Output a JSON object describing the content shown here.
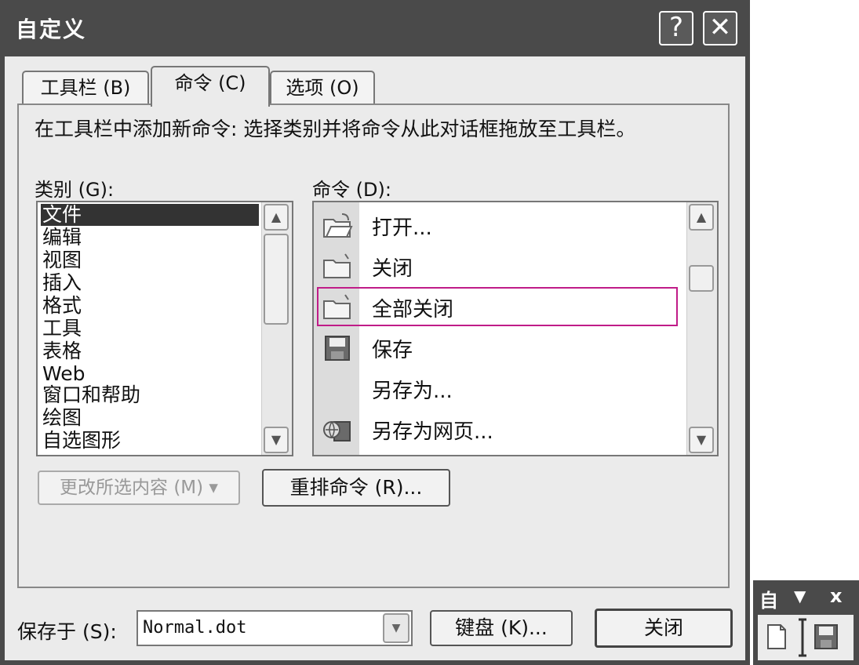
{
  "window": {
    "title": "自定义",
    "help_btn": "?",
    "close_btn": "✕"
  },
  "tabs": [
    {
      "label": "工具栏 (B)"
    },
    {
      "label": "命令 (C)"
    },
    {
      "label": "选项 (O)"
    }
  ],
  "panel": {
    "description": "在工具栏中添加新命令: 选择类别并将命令从此对话框拖放至工具栏。",
    "categories_label": "类别 (G):",
    "commands_label": "命令 (D):",
    "categories": [
      "文件",
      "编辑",
      "视图",
      "插入",
      "格式",
      "工具",
      "表格",
      "Web",
      "窗口和帮助",
      "绘图",
      "自选图形"
    ],
    "commands": [
      {
        "label": "打开...",
        "icon": "open-folder-icon"
      },
      {
        "label": "关闭",
        "icon": "close-folder-icon"
      },
      {
        "label": "全部关闭",
        "icon": "close-all-folder-icon"
      },
      {
        "label": "保存",
        "icon": "save-disk-icon"
      },
      {
        "label": "另存为...",
        "icon": ""
      },
      {
        "label": "另存为网页...",
        "icon": "save-as-web-icon"
      }
    ],
    "modify_selection": "更改所选内容 (M) ▾",
    "rearrange": "重排命令 (R)..."
  },
  "footer": {
    "save_in_label": "保存于 (S):",
    "save_in_value": "Normal.dot",
    "keyboard": "键盘 (K)...",
    "close": "关闭"
  },
  "mini_toolbar": {
    "title": "自",
    "arrow": "▼",
    "close": "x"
  }
}
